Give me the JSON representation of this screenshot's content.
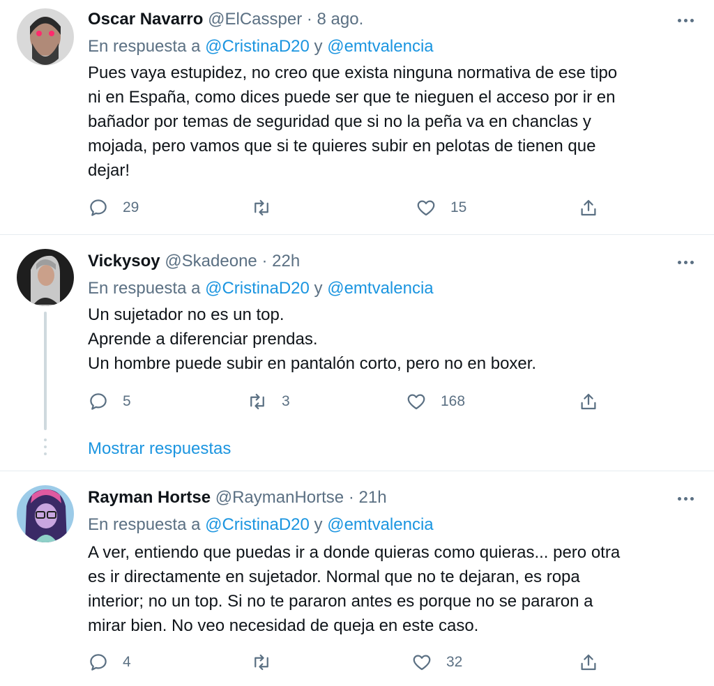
{
  "tweets": [
    {
      "name": "Oscar Navarro",
      "handle": "@ElCassper",
      "separator": "·",
      "time": "8 ago.",
      "reply_prefix": "En respuesta a",
      "mention1": "@CristinaD20",
      "reply_joiner": "y",
      "mention2": "@emtvalencia",
      "body": [
        "Pues vaya estupidez, no creo que exista ninguna normativa de ese tipo",
        "ni en España, como dices puede ser que te nieguen el acceso por ir en",
        "bañador por temas de seguridad que si no la peña va en chanclas y",
        "mojada, pero vamos que si te quieres subir en pelotas de tienen que",
        "dejar!"
      ],
      "replies": "29",
      "retweets": "",
      "likes": "15",
      "avatar_colors": [
        "#3a3a3a",
        "#e8e8e8"
      ]
    },
    {
      "name": "Vickysoy",
      "handle": "@Skadeone",
      "separator": "·",
      "time": "22h",
      "reply_prefix": "En respuesta a",
      "mention1": "@CristinaD20",
      "reply_joiner": "y",
      "mention2": "@emtvalencia",
      "body": [
        "Un sujetador no es un top.",
        "Aprende a diferenciar prendas.",
        "Un hombre puede subir en pantalón corto, pero no en boxer."
      ],
      "replies": "5",
      "retweets": "3",
      "likes": "168",
      "avatar_colors": [
        "#1a1a1a",
        "#bdbdbd"
      ]
    },
    {
      "name": "Rayman Hortse",
      "handle": "@RaymanHortse",
      "separator": "·",
      "time": "21h",
      "reply_prefix": "En respuesta a",
      "mention1": "@CristinaD20",
      "reply_joiner": "y",
      "mention2": "@emtvalencia",
      "body": [
        "A ver, entiendo que puedas ir a donde quieras como quieras... pero otra",
        "es ir directamente en sujetador. Normal que no te dejaran, es ropa",
        "interior; no un top. Si no te pararon antes es porque no se pararon a",
        "mirar bien. No veo necesidad de queja en este caso."
      ],
      "replies": "4",
      "retweets": "",
      "likes": "32",
      "avatar_colors": [
        "#5a3d8a",
        "#8fb9e0"
      ]
    }
  ],
  "show_replies_label": "Mostrar respuestas",
  "colors": {
    "link": "#1b95e0",
    "secondary": "#5b7083",
    "text": "#0f1419",
    "divider": "#e6ecf0"
  },
  "icons": [
    "reply-icon",
    "retweet-icon",
    "like-icon",
    "share-icon",
    "more-icon"
  ]
}
